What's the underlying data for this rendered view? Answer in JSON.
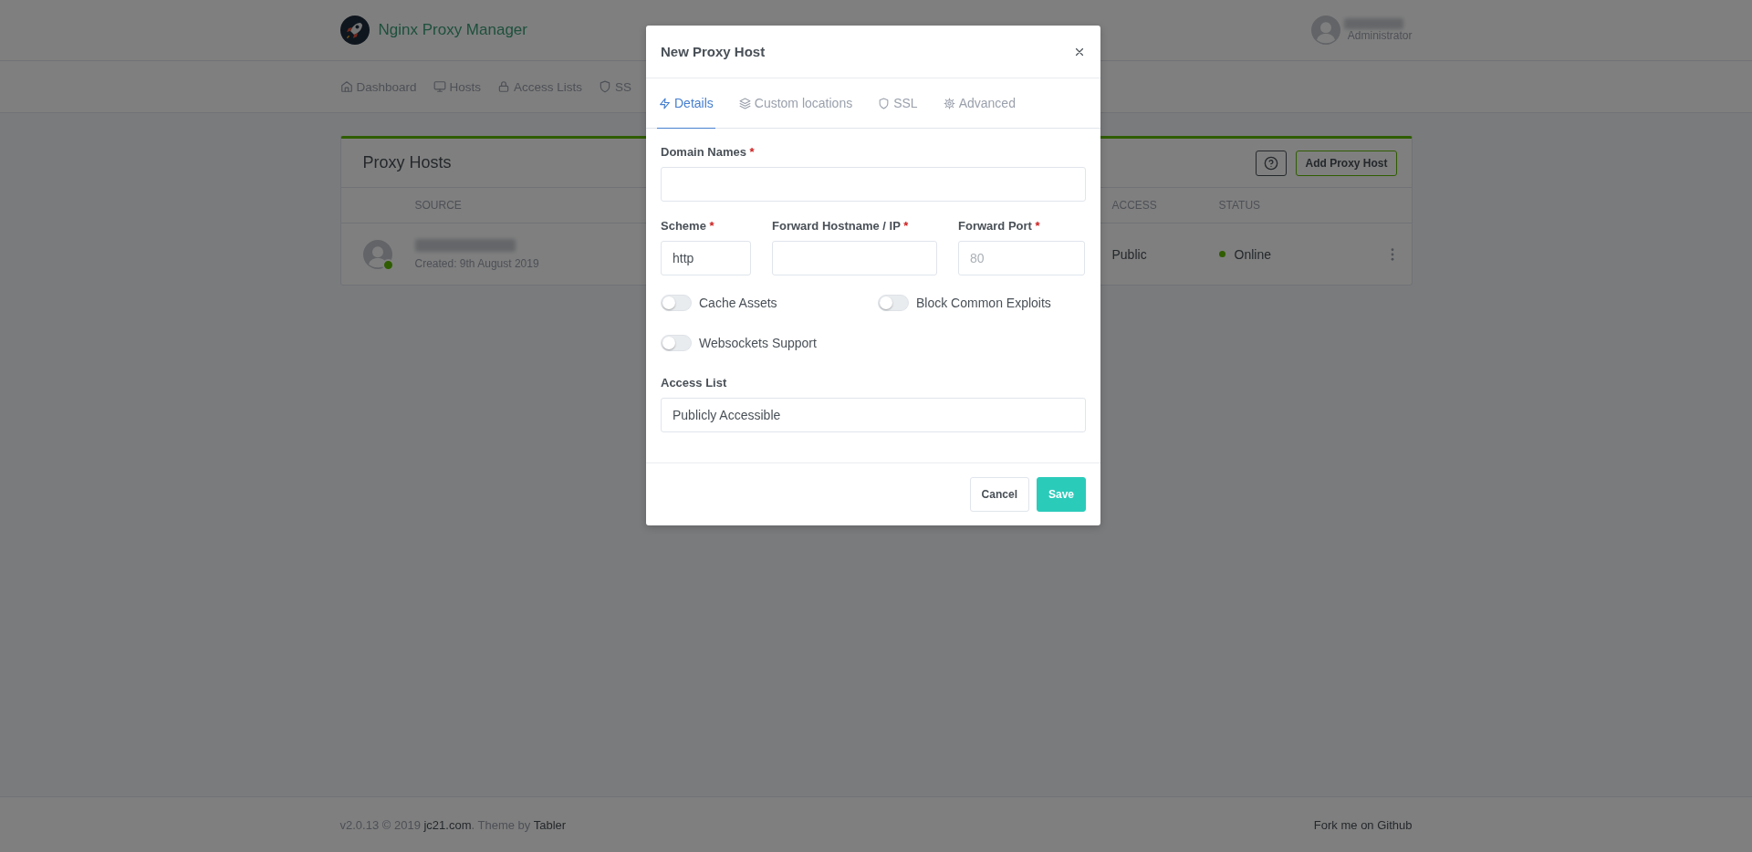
{
  "header": {
    "brand": "Nginx Proxy Manager",
    "user": {
      "role": "Administrator"
    }
  },
  "nav": [
    {
      "label": "Dashboard",
      "selected": false
    },
    {
      "label": "Hosts",
      "selected": false
    },
    {
      "label": "Access Lists",
      "selected": false
    },
    {
      "label": "SS",
      "selected": false
    }
  ],
  "card": {
    "title": "Proxy Hosts",
    "add_button": "Add Proxy Host",
    "table": {
      "columns": [
        "SOURCE",
        "ACCESS",
        "STATUS"
      ],
      "rows": [
        {
          "created": "Created: 9th August 2019",
          "access": "Public",
          "status": "Online",
          "online": true
        }
      ]
    }
  },
  "modal": {
    "title": "New Proxy Host",
    "tabs": [
      {
        "label": "Details",
        "selected": true
      },
      {
        "label": "Custom locations",
        "selected": false
      },
      {
        "label": "SSL",
        "selected": false
      },
      {
        "label": "Advanced",
        "selected": false
      }
    ],
    "domain": {
      "label": "Domain Names",
      "required_mark": "*"
    },
    "forward": [
      {
        "label": "Scheme",
        "required_mark": "*",
        "value": "http"
      },
      {
        "label": "Forward Hostname / IP",
        "required_mark": "*"
      },
      {
        "label": "Forward Port",
        "required_mark": "*",
        "placeholder": "80"
      }
    ],
    "toggles": [
      {
        "label": "Cache Assets",
        "checked": false
      },
      {
        "label": "Block Common Exploits",
        "checked": false
      },
      {
        "label": "Websockets Support",
        "checked": false
      }
    ],
    "access_list": {
      "label": "Access List",
      "value": "Publicly Accessible"
    },
    "buttons": [
      {
        "label": "Cancel",
        "kind": "secondary"
      },
      {
        "label": "Save",
        "kind": "primary"
      }
    ]
  },
  "footer": {
    "parts": [
      {
        "kind": "text",
        "text": "v2.0.13 © 2019 "
      },
      {
        "kind": "link",
        "text": "jc21.com"
      },
      {
        "kind": "text",
        "text": ". Theme by "
      },
      {
        "kind": "link",
        "text": "Tabler"
      }
    ],
    "right_link": "Fork me on Github"
  }
}
